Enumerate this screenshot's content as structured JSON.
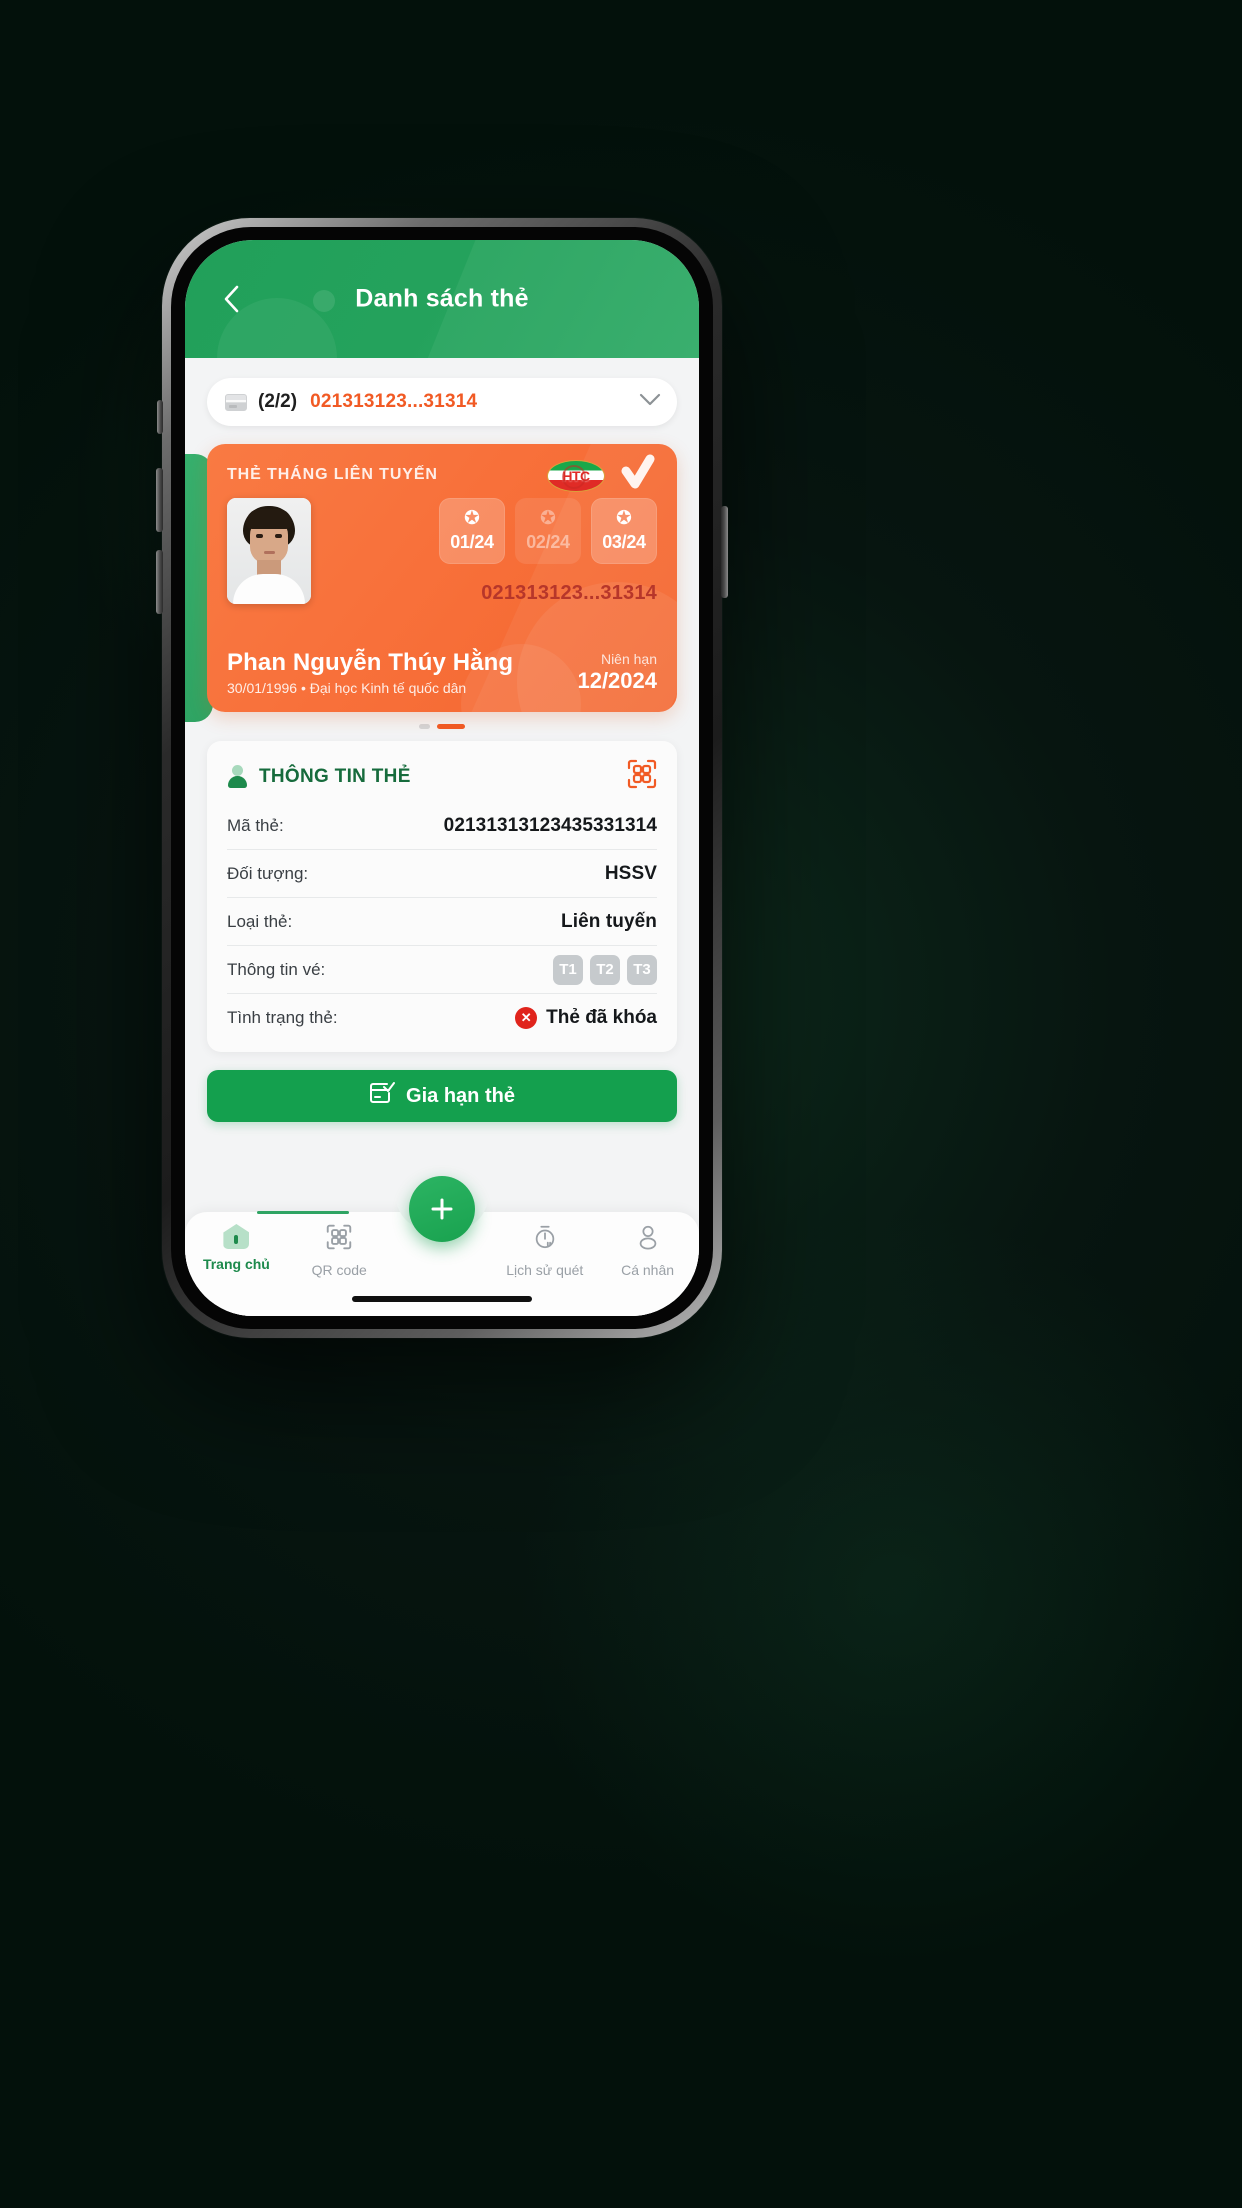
{
  "header": {
    "title": "Danh sách thẻ",
    "back_icon": "chevron-left-icon"
  },
  "selector": {
    "icon": "credit-card-icon",
    "count": "(2/2)",
    "code": "021313123...31314",
    "caret_icon": "chevron-down-icon"
  },
  "card": {
    "title": "THẺ THÁNG LIÊN TUYẾN",
    "brand_text": "HTC",
    "verified_icon": "check-icon",
    "months": [
      {
        "label": "01/24",
        "state": "active",
        "icon": "star-icon"
      },
      {
        "label": "02/24",
        "state": "dim",
        "icon": "star-icon"
      },
      {
        "label": "03/24",
        "state": "active",
        "icon": "star-icon"
      }
    ],
    "code": "021313123...31314",
    "name": "Phan Nguyễn Thúy Hằng",
    "subtitle": "30/01/1996 • Đại học Kinh tế quốc dân",
    "expiry_label": "Niên hạn",
    "expiry_value": "12/2024",
    "accent_color": "#f4662f",
    "code_color": "#b7362a"
  },
  "pagination": {
    "total": 2,
    "current": 2
  },
  "info": {
    "title": "THÔNG TIN THẺ",
    "person_icon": "person-icon",
    "qr_icon": "qr-code-icon",
    "title_color": "#166b3c",
    "rows": [
      {
        "label": "Mã thẻ:",
        "value": "02131313123435331314",
        "type": "text"
      },
      {
        "label": "Đối tượng:",
        "value": "HSSV",
        "type": "text"
      },
      {
        "label": "Loại thẻ:",
        "value": "Liên tuyến",
        "type": "text"
      },
      {
        "label": "Thông tin vé:",
        "value": "",
        "type": "tickets",
        "tickets": [
          "T1",
          "T2",
          "T3"
        ]
      },
      {
        "label": "Tình trạng thẻ:",
        "value": "Thẻ đã khóa",
        "type": "status",
        "status_icon": "x-circle-icon",
        "status_color": "#e0241c"
      }
    ]
  },
  "renew_button": {
    "label": "Gia hạn thẻ",
    "icon": "card-check-icon",
    "color": "#14a04e"
  },
  "fab": {
    "icon": "plus-icon",
    "color": "#19a24f"
  },
  "bottom_nav": {
    "items": [
      {
        "label": "Trang chủ",
        "icon": "home-icon",
        "active": true
      },
      {
        "label": "QR code",
        "icon": "qr-code-icon",
        "active": false
      },
      {
        "label": "Lịch sử quét",
        "icon": "stopwatch-icon",
        "active": false
      },
      {
        "label": "Cá nhân",
        "icon": "person-outline-icon",
        "active": false
      }
    ]
  }
}
